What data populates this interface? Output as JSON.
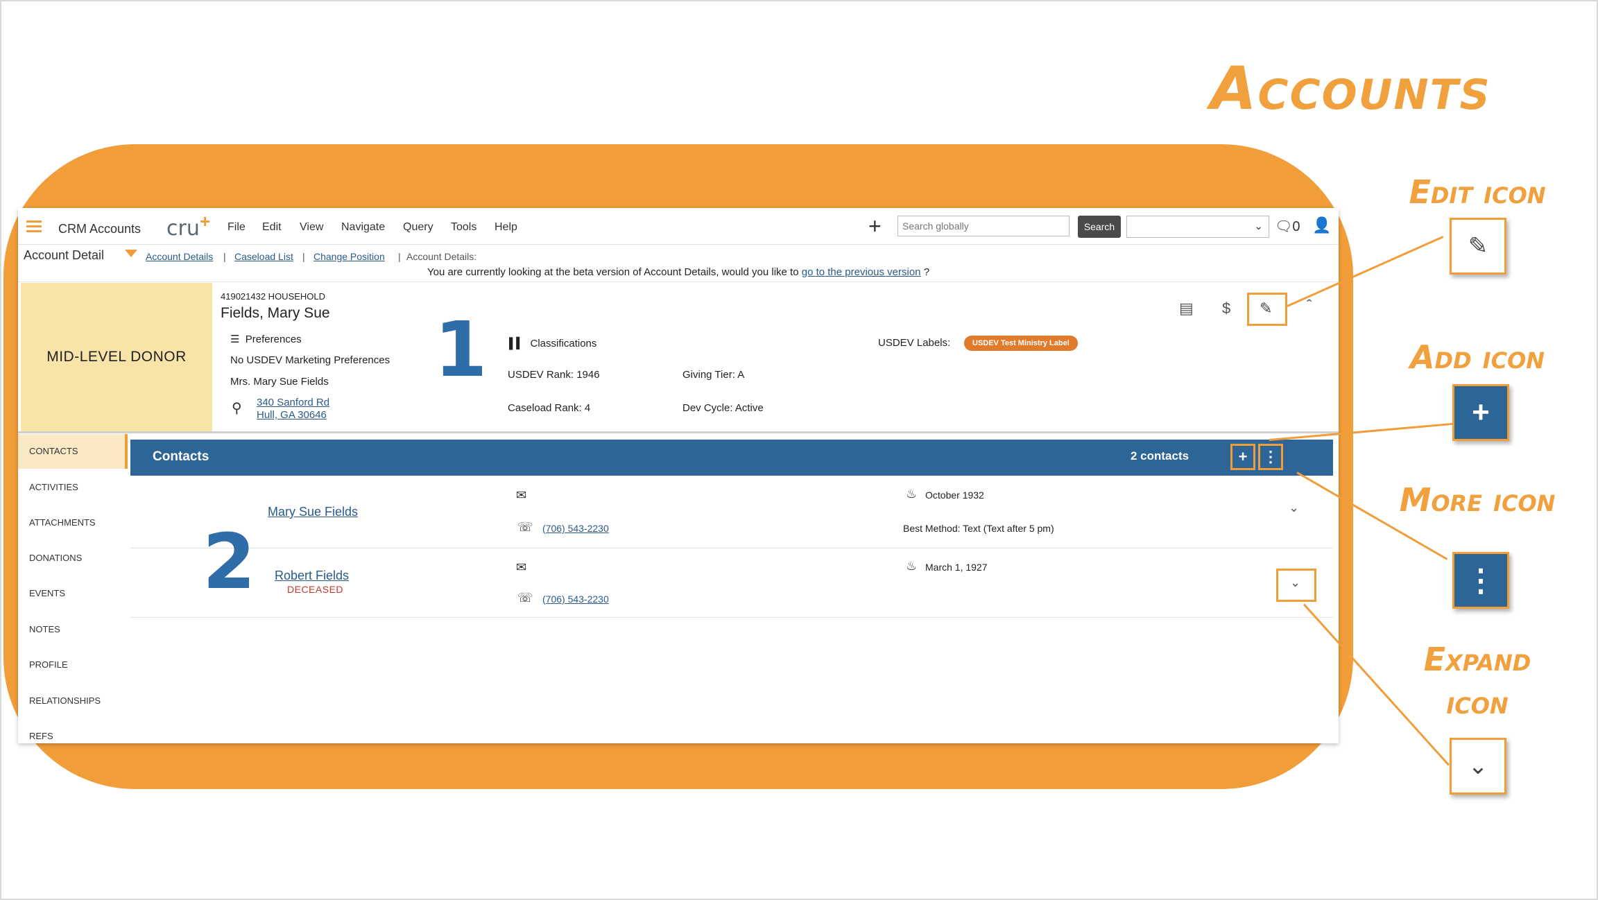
{
  "slide": {
    "title": "Accounts",
    "callouts": {
      "edit": "Edit icon",
      "add": "Add icon",
      "more": "More icon",
      "expand_line1": "Expand",
      "expand_line2": "icon"
    },
    "markers": [
      "1",
      "2"
    ]
  },
  "colors": {
    "accent": "#f09d3a",
    "primary": "#2c6596",
    "donor_bg": "#f8e3a8",
    "label_pill": "#e07b2b",
    "deceased": "#c0392b"
  },
  "app": {
    "title": "CRM Accounts",
    "logo": "cru",
    "menu": [
      "File",
      "Edit",
      "View",
      "Navigate",
      "Query",
      "Tools",
      "Help"
    ],
    "search": {
      "placeholder": "Search globally",
      "button": "Search"
    },
    "notification_count": "0"
  },
  "breadcrumb": {
    "title": "Account Detail",
    "links": [
      "Account Details",
      "Caseload List",
      "Change Position"
    ],
    "current": "Account Details:"
  },
  "beta_notice": {
    "text": "You are currently looking at the beta version of Account Details, would you like to",
    "link": "go to the previous version",
    "suffix": "?"
  },
  "account": {
    "donor_level": "MID-LEVEL DONOR",
    "id_line": "419021432 HOUSEHOLD",
    "name": "Fields, Mary Sue",
    "preferences_label": "Preferences",
    "marketing_pref": "No USDEV Marketing Preferences",
    "salutation": "Mrs. Mary Sue Fields",
    "address_line1": "340 Sanford Rd",
    "address_line2": "Hull, GA 30646",
    "classifications_label": "Classifications",
    "usdev_rank_label": "USDEV Rank:",
    "usdev_rank": "1946",
    "giving_tier_label": "Giving Tier:",
    "giving_tier": "A",
    "caseload_rank_label": "Caseload Rank:",
    "caseload_rank": "4",
    "dev_cycle_label": "Dev Cycle:",
    "dev_cycle": "Active",
    "usdev_labels_label": "USDEV Labels:",
    "usdev_label_pill": "USDEV Test Ministry Label",
    "header_icons": [
      "chat-icon",
      "dollar-icon",
      "edit-icon",
      "chevron-up-icon"
    ]
  },
  "sidebar": {
    "items": [
      "CONTACTS",
      "ACTIVITIES",
      "ATTACHMENTS",
      "DONATIONS",
      "EVENTS",
      "NOTES",
      "PROFILE",
      "RELATIONSHIPS",
      "REFS"
    ],
    "active": "CONTACTS"
  },
  "contacts": {
    "title": "Contacts",
    "count": "2 contacts",
    "rows": [
      {
        "name": "Mary Sue Fields",
        "status": "",
        "phone": "(706) 543-2230",
        "birth": "October 1932",
        "best_method": "Best Method:  Text (Text after 5 pm)"
      },
      {
        "name": "Robert Fields",
        "status": "DECEASED",
        "phone": "(706) 543-2230",
        "birth": "March 1, 1927",
        "best_method": ""
      }
    ]
  }
}
